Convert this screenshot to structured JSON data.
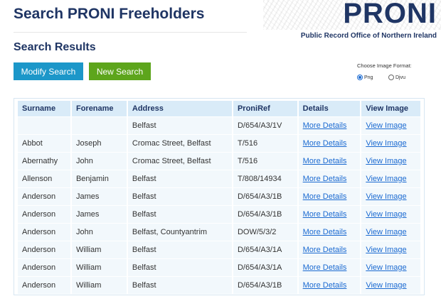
{
  "header": {
    "title": "Search PRONI Freeholders"
  },
  "logo": {
    "word": "PRONI",
    "subtitle": "Public Record Office of Northern Ireland"
  },
  "results": {
    "title": "Search Results"
  },
  "buttons": {
    "modify": "Modify Search",
    "new": "New Search"
  },
  "image_format": {
    "label": "Choose Image Format:",
    "options": [
      {
        "label": "Png",
        "selected": true
      },
      {
        "label": "Djvu",
        "selected": false
      }
    ]
  },
  "table": {
    "headers": [
      "Surname",
      "Forename",
      "Address",
      "ProniRef",
      "Details",
      "View Image"
    ],
    "rows": [
      {
        "surname": "",
        "forename": "",
        "address": "Belfast",
        "ref": "D/654/A3/1V",
        "details": "More Details",
        "view": "View Image"
      },
      {
        "surname": "Abbot",
        "forename": "Joseph",
        "address": "Cromac Street, Belfast",
        "ref": "T/516",
        "details": "More Details",
        "view": "View Image"
      },
      {
        "surname": "Abernathy",
        "forename": "John",
        "address": "Cromac Street, Belfast",
        "ref": "T/516",
        "details": "More Details",
        "view": "View Image"
      },
      {
        "surname": "Allenson",
        "forename": "Benjamin",
        "address": "Belfast",
        "ref": "T/808/14934",
        "details": "More Details",
        "view": "View Image"
      },
      {
        "surname": "Anderson",
        "forename": "James",
        "address": "Belfast",
        "ref": "D/654/A3/1B",
        "details": "More Details",
        "view": "View Image"
      },
      {
        "surname": "Anderson",
        "forename": "James",
        "address": "Belfast",
        "ref": "D/654/A3/1B",
        "details": "More Details",
        "view": "View Image"
      },
      {
        "surname": "Anderson",
        "forename": "John",
        "address": "Belfast, Countyantrim",
        "ref": "DOW/5/3/2",
        "details": "More Details",
        "view": "View Image"
      },
      {
        "surname": "Anderson",
        "forename": "William",
        "address": "Belfast",
        "ref": "D/654/A3/1A",
        "details": "More Details",
        "view": "View Image"
      },
      {
        "surname": "Anderson",
        "forename": "William",
        "address": "Belfast",
        "ref": "D/654/A3/1A",
        "details": "More Details",
        "view": "View Image"
      },
      {
        "surname": "Anderson",
        "forename": "William",
        "address": "Belfast",
        "ref": "D/654/A3/1B",
        "details": "More Details",
        "view": "View Image"
      }
    ]
  }
}
